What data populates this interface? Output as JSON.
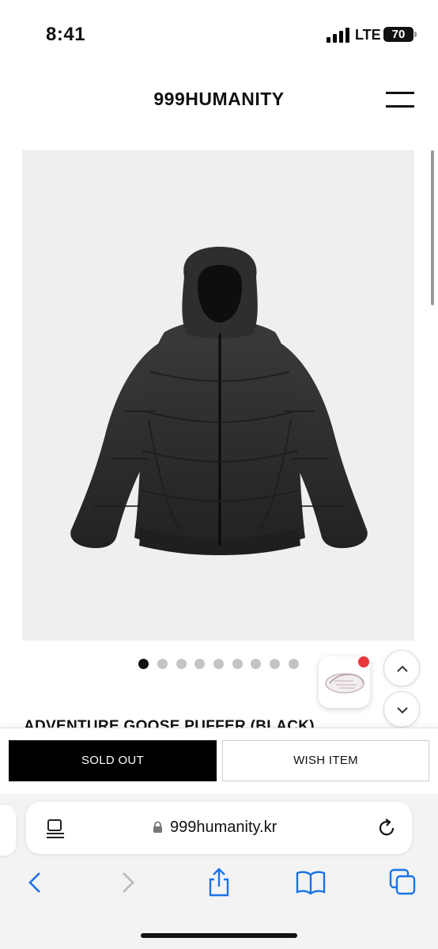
{
  "status": {
    "time": "8:41",
    "network": "LTE",
    "battery": "70"
  },
  "site": {
    "logo": "999HUMANITY"
  },
  "product": {
    "title": "ADVENTURE GOOSE PUFFER (BLACK)",
    "image_count": 9,
    "active_image": 1
  },
  "actions": {
    "sold_out_label": "SOLD OUT",
    "wish_label": "WISH ITEM"
  },
  "browser": {
    "url": "999humanity.kr"
  },
  "colors": {
    "primary_button": "#000000",
    "badge": "#e8383d",
    "accent": "#1a73e8"
  }
}
